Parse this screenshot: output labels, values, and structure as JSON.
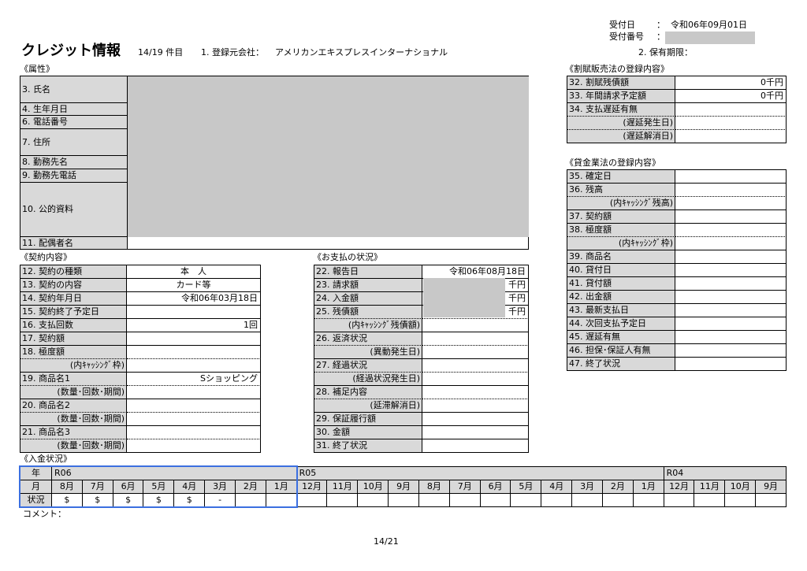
{
  "colors": {
    "label_background": "#d9d9d9",
    "redaction": "#c8c8c8",
    "highlight": "#3b6fe0"
  },
  "receipt": {
    "date_label": "受付日",
    "separator": "：",
    "date_value": "令和06年09月01日",
    "number_label": "受付番号"
  },
  "header": {
    "title": "クレジット情報",
    "record_position": "14/19 件目",
    "registrant_label": "1. 登録元会社：",
    "registrant_name": "アメリカンエキスプレスインターナショナル",
    "retention_label": "2. 保有期限："
  },
  "attributes": {
    "section_title": "《属性》",
    "rows": [
      {
        "label": "3. 氏名"
      },
      {
        "label": "4. 生年月日"
      },
      {
        "label": "6. 電話番号"
      },
      {
        "label": "7. 住所"
      },
      {
        "label": "8. 勤務先名"
      },
      {
        "label": "9. 勤務先電話"
      },
      {
        "label": "10. 公的資料"
      },
      {
        "label": "11. 配偶者名"
      }
    ]
  },
  "installment_law": {
    "section_title": "《割賦販売法の登録内容》",
    "rows": [
      {
        "label": "32. 割賦残債額",
        "value": "0千円"
      },
      {
        "label": "33. 年間請求予定額",
        "value": "0千円"
      },
      {
        "label": "34. 支払遅延有無"
      },
      {
        "label": "(遅延発生日)"
      },
      {
        "label": "(遅延解消日)"
      }
    ]
  },
  "money_lending_law": {
    "section_title": "《貸金業法の登録内容》",
    "rows": [
      {
        "label": "35. 確定日"
      },
      {
        "label": "36. 残高"
      },
      {
        "label": "(内ｷｬｯｼﾝｸﾞ残高)"
      },
      {
        "label": "37. 契約額"
      },
      {
        "label": "38. 極度額"
      },
      {
        "label": "(内ｷｬｯｼﾝｸﾞ枠)"
      },
      {
        "label": "39. 商品名"
      },
      {
        "label": "40. 貸付日"
      },
      {
        "label": "41. 貸付額"
      },
      {
        "label": "42. 出金額"
      },
      {
        "label": "43. 最新支払日"
      },
      {
        "label": "44. 次回支払予定日"
      },
      {
        "label": "45. 遅延有無"
      },
      {
        "label": "46. 担保･保証人有無"
      },
      {
        "label": "47. 終了状況"
      }
    ]
  },
  "contract": {
    "section_title": "《契約内容》",
    "rows": [
      {
        "label": "12. 契約の種類",
        "value": "本　人"
      },
      {
        "label": "13. 契約の内容",
        "value": "カード等"
      },
      {
        "label": "14. 契約年月日",
        "value": "令和06年03月18日"
      },
      {
        "label": "15. 契約終了予定日"
      },
      {
        "label": "16. 支払回数",
        "value": "1回"
      },
      {
        "label": "17. 契約額"
      },
      {
        "label": "18. 極度額"
      },
      {
        "label": "(内ｷｬｯｼﾝｸﾞ枠)"
      },
      {
        "label": "19. 商品名1",
        "value": "Sショッピング"
      },
      {
        "label": "(数量･回数･期間)"
      },
      {
        "label": "20. 商品名2"
      },
      {
        "label": "(数量･回数･期間)"
      },
      {
        "label": "21. 商品名3"
      },
      {
        "label": "(数量･回数･期間)"
      }
    ]
  },
  "payment_state": {
    "section_title": "《お支払の状況》",
    "rows": [
      {
        "label": "22. 報告日",
        "value": "令和06年08月18日"
      },
      {
        "label": "23. 請求額",
        "value": "千円"
      },
      {
        "label": "24. 入金額",
        "value": "千円"
      },
      {
        "label": "25. 残債額",
        "value": "千円"
      },
      {
        "label": "(内ｷｬｯｼﾝｸﾞ残債額)"
      },
      {
        "label": "26. 返済状況"
      },
      {
        "label": "(異動発生日)"
      },
      {
        "label": "27. 経過状況"
      },
      {
        "label": "(経過状況発生日)"
      },
      {
        "label": "28. 補足内容"
      },
      {
        "label": "(延滞解消日)"
      },
      {
        "label": "29. 保証履行額"
      },
      {
        "label": "30. 金額"
      },
      {
        "label": "31. 終了状況"
      }
    ]
  },
  "payment_status": {
    "section_title": "《入金状況》",
    "row_labels": {
      "year": "年",
      "month": "月",
      "status": "状況"
    },
    "years": [
      {
        "label": "R06",
        "months": [
          "8月",
          "7月",
          "6月",
          "5月",
          "4月",
          "3月",
          "2月",
          "1月"
        ],
        "status": [
          "$",
          "$",
          "$",
          "$",
          "$",
          "-"
        ]
      },
      {
        "label": "R05",
        "months": [
          "12月",
          "11月",
          "10月",
          "9月",
          "8月",
          "7月",
          "6月",
          "5月",
          "4月",
          "3月",
          "2月",
          "1月"
        ],
        "status": []
      },
      {
        "label": "R04",
        "months": [
          "12月",
          "11月",
          "10月",
          "9月"
        ],
        "status": []
      }
    ]
  },
  "comment_label": "コメント：",
  "page_number": "14/21"
}
